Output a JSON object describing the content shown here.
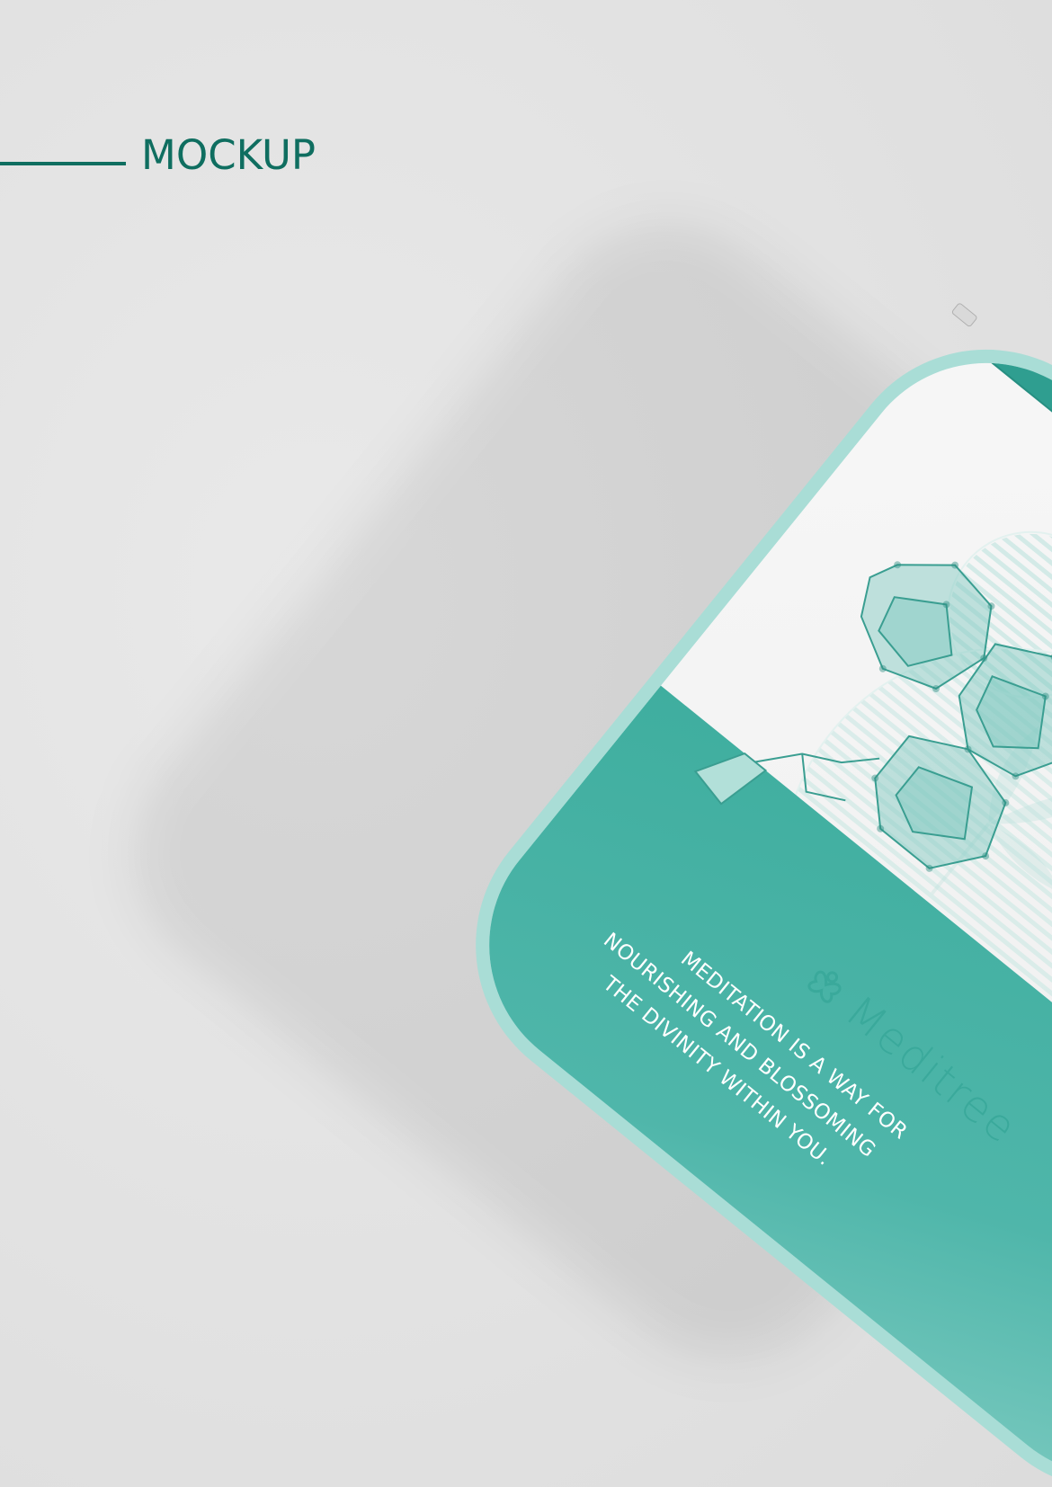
{
  "header": {
    "title": "MOCKUP"
  },
  "sleeve": {
    "brand_name": "Meditree",
    "quote_lines": [
      "MEDITATION IS A WAY FOR",
      "NOURISHING AND BLOSSOMING",
      "THE DIVINITY WITHIN YOU."
    ]
  },
  "colors": {
    "accent": "#0f6e60",
    "teal": "#4db3a8",
    "teal_light": "#a8ddd6",
    "paper": "#f2f2f2",
    "background": "#e3e3e3"
  },
  "icons": {
    "brand_logo": "lotus-knot-icon",
    "illustration": "low-poly-bonsai-tree",
    "leaf_watermark": "leaf-sprig-icon"
  }
}
